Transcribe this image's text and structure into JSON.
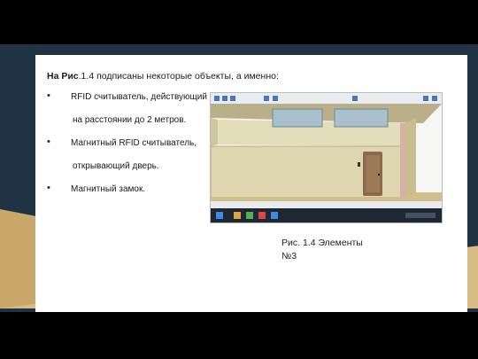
{
  "slide": {
    "heading_bold": "На Рис",
    "heading_rest": ".1.4 подписаны некоторые объекты, а именно:",
    "items": [
      {
        "line1": "RFID считыватель, действующий",
        "line2": "на расстоянии до 2 метров."
      },
      {
        "line1": "Магнитный RFID считыватель,",
        "line2": "открывающий дверь."
      },
      {
        "line1": "Магнитный замок."
      }
    ],
    "bullet_symbol": "•",
    "caption_line1": "Рис. 1.4 Элементы",
    "caption_line2": "№3"
  },
  "colors": {
    "background_dark": "#1f3344",
    "accent_gold": "#c9a86a",
    "wall": "#ded7b0",
    "floor": "#d2c08a",
    "door": "#8a6a4a"
  },
  "figure_icons": [
    "app-toolbar-icon",
    "windows-taskbar-icon",
    "door-icon"
  ]
}
